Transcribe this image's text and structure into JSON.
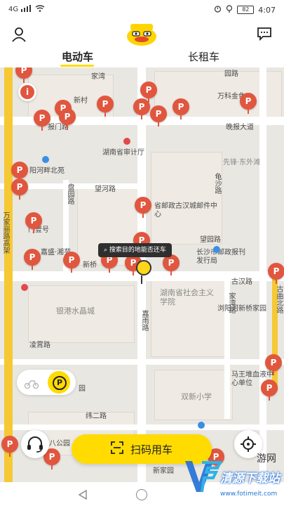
{
  "status_bar": {
    "network": "4G",
    "battery": "82",
    "time": "4:07"
  },
  "header": {
    "left_icon": "user-icon",
    "logo": "duck-logo",
    "right_icon": "message-icon"
  },
  "tabs": [
    {
      "label": "电动车",
      "active": true
    },
    {
      "label": "长租车",
      "active": false
    }
  ],
  "map": {
    "tooltip": "搜索目的地能否还车",
    "labels": {
      "家湾": "家湾",
      "新村": "新村",
      "报门路": "报门路",
      "湖南省审计厅": "湖南省审计厅",
      "阳河畔北苑": "阳河畔北苑",
      "望河路": "望河路",
      "盘园路": "盘园路",
      "省邮政古汉城邮件中心": "省邮政古汉城邮件中心",
      "门壹号": "门壹号",
      "嘉盛湘苑": "嘉盛·湘苑",
      "新桥": "新桥",
      "长沙市邮政报刊发行局": "长沙市邮政报刊发行局",
      "望园路": "望园路",
      "古汉路": "古汉路",
      "湖南省社会主义学院": "湖南省社会主义学院",
      "银港水晶城": "银港水晶城",
      "嘉雨路": "嘉雨路",
      "家湾路": "家湾路",
      "浏阳河新桥家园": "浏阳河新桥家园",
      "凌霄路": "凌霄路",
      "园": "园",
      "双新小学": "双新小学",
      "马王堆血液中心单位": "马王堆血液中心单位",
      "纬二路": "纬二路",
      "八公园": "八公园",
      "新家园": "新家园",
      "先锋东外滩": "先锋·东外滩",
      "晚报大道": "晚报大道",
      "万科金色": "万科金色",
      "园路": "园路",
      "龟沙路": "龟沙路",
      "古曲北路": "古曲北路",
      "万家丽路高架": "万家丽路高架"
    }
  },
  "controls": {
    "scan_label": "扫码用车",
    "customer_service_icon": "headset-icon",
    "locate_icon": "locate-icon",
    "bike_icon": "scooter-icon",
    "parking_icon": "parking-icon"
  },
  "watermark": {
    "text": "清源下载站",
    "sub": "游网",
    "url": "www.fotimeit.com"
  },
  "colors": {
    "accent": "#ffdb00",
    "pin": "#e1563e"
  }
}
